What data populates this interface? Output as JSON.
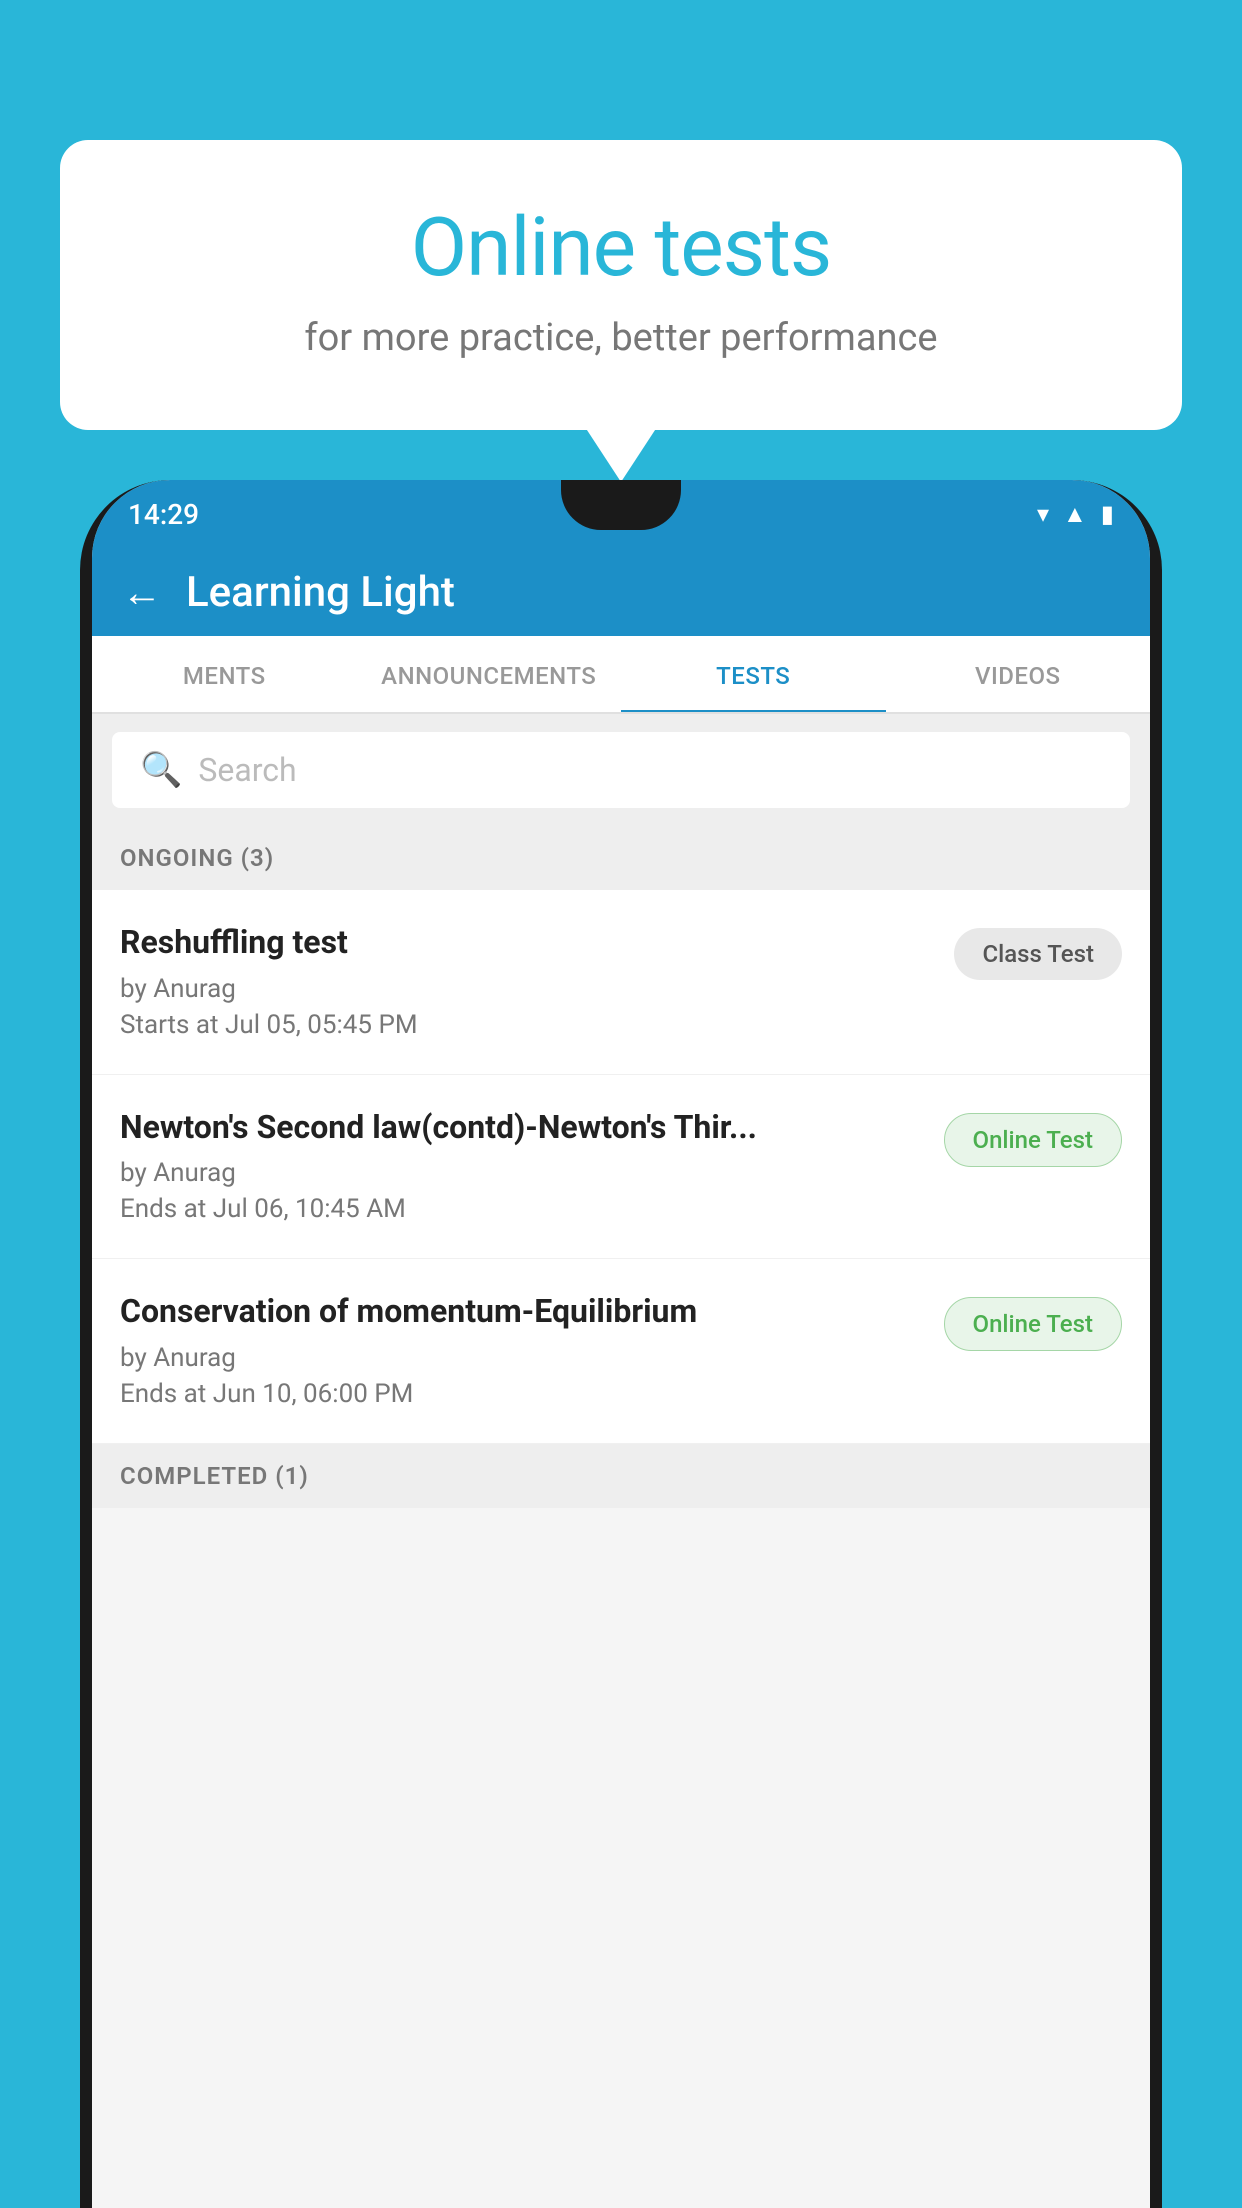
{
  "background_color": "#29b6d8",
  "speech_bubble": {
    "title": "Online tests",
    "subtitle": "for more practice, better performance"
  },
  "status_bar": {
    "time": "14:29",
    "icons": [
      "wifi",
      "signal",
      "battery"
    ]
  },
  "app_header": {
    "back_label": "←",
    "title": "Learning Light"
  },
  "tabs": [
    {
      "label": "MENTS",
      "active": false
    },
    {
      "label": "ANNOUNCEMENTS",
      "active": false
    },
    {
      "label": "TESTS",
      "active": true
    },
    {
      "label": "VIDEOS",
      "active": false
    }
  ],
  "search": {
    "placeholder": "Search"
  },
  "ongoing_section": {
    "label": "ONGOING (3)"
  },
  "tests": [
    {
      "name": "Reshuffling test",
      "author": "by Anurag",
      "time_label": "Starts at",
      "time": "Jul 05, 05:45 PM",
      "badge": "Class Test",
      "badge_type": "class"
    },
    {
      "name": "Newton's Second law(contd)-Newton's Thir...",
      "author": "by Anurag",
      "time_label": "Ends at",
      "time": "Jul 06, 10:45 AM",
      "badge": "Online Test",
      "badge_type": "online"
    },
    {
      "name": "Conservation of momentum-Equilibrium",
      "author": "by Anurag",
      "time_label": "Ends at",
      "time": "Jun 10, 06:00 PM",
      "badge": "Online Test",
      "badge_type": "online"
    }
  ],
  "completed_section": {
    "label": "COMPLETED (1)"
  }
}
